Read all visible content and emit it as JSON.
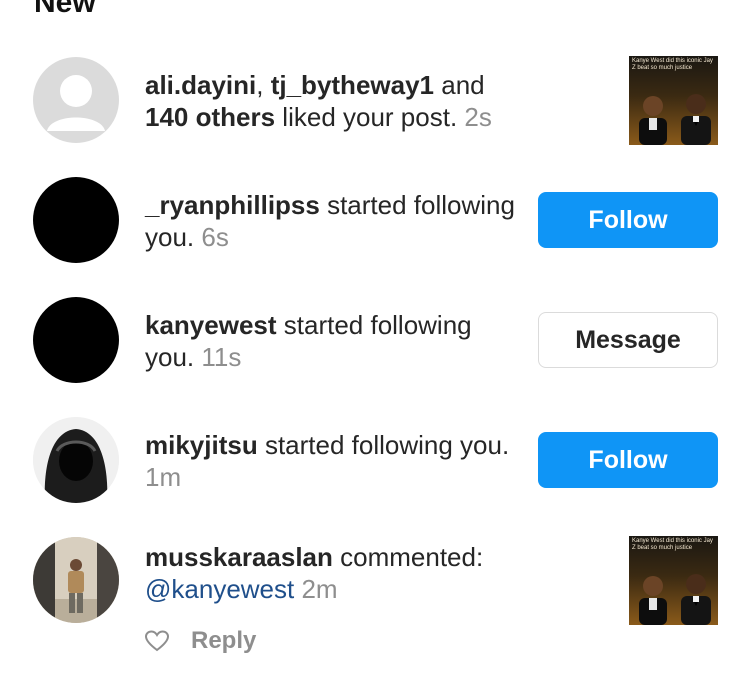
{
  "header": {
    "title_partial": "New"
  },
  "notifications": [
    {
      "avatar": "default-avatar",
      "user1": "ali.dayini",
      "sep": ", ",
      "user2": "tj_bytheway1",
      "and": " and ",
      "others": "140 others",
      "action": " liked your post.",
      "time": "2s",
      "thumb_caption": "Kanye West did this iconic Jay Z beat so much justice"
    },
    {
      "avatar": "black-avatar",
      "user": "_ryanphillipss",
      "action": " started following you.",
      "time": "6s",
      "button": "Follow"
    },
    {
      "avatar": "black-avatar",
      "user": "kanyewest",
      "action": " started following you.",
      "time": "11s",
      "button": "Message"
    },
    {
      "avatar": "hooded-figure-avatar",
      "user": "mikyjitsu",
      "action": " started following you.",
      "time": "1m",
      "button": "Follow"
    },
    {
      "avatar": "photo-avatar",
      "user": "musskaraaslan",
      "action": " commented:",
      "mention": "@kanyewest",
      "time": "2m",
      "thumb_caption": "Kanye West did this iconic Jay Z beat so much justice",
      "reply_label": "Reply",
      "like_icon": "heart-outline-icon"
    }
  ],
  "colors": {
    "follow_button": "#0f95f6",
    "timestamp": "#8e8e8e",
    "mention": "#1f4f8b",
    "text": "#262626"
  }
}
